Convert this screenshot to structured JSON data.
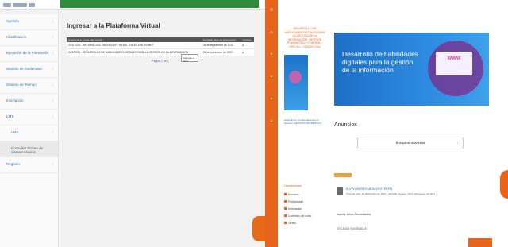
{
  "left": {
    "sidebar": [
      {
        "label": "Sysfinfo",
        "sub": false,
        "active": false
      },
      {
        "label": "Clasificación",
        "sub": false,
        "active": false
      },
      {
        "label": "Ejecución de la Formación",
        "sub": false,
        "active": false
      },
      {
        "label": "Gestión de Evidencias",
        "sub": false,
        "active": false
      },
      {
        "label": "Gestión de Tiempo",
        "sub": false,
        "active": false
      },
      {
        "label": "Inscripción",
        "sub": false,
        "active": false
      },
      {
        "label": "LMS",
        "sub": false,
        "active": false
      },
      {
        "label": "LMS",
        "sub": true,
        "active": false
      },
      {
        "label": "Consultar Fichas de Caracterización",
        "sub": true,
        "active": true
      },
      {
        "label": "Registro",
        "sub": false,
        "active": false
      }
    ],
    "title": "Ingresar a la Plataforma Virtual",
    "table": {
      "headers": [
        "Programa en el que esta inscrito",
        "Fecha de Inicio de la formación",
        "Ingresar"
      ],
      "rows": [
        [
          "GESTIÓN - INFORMÁTICA - MICROSOFT WORD, EXCEL E INTERNET",
          "05 de septiembre de 2021",
          ""
        ],
        [
          "GESTIÓN - DESARROLLO DE HABILIDADES DIGITALES PARA LA GESTIÓN DE LA INFORMACIÓN",
          "05 de noviembre de 2021",
          ""
        ]
      ]
    },
    "pager": "Página 1 de 1",
    "tooltip": "Ingresar a Terri"
  },
  "right": {
    "course_title": "DESARROLLO DE HABILIDADES DIGITALES PARA LA GESTIÓN DE LA INFORMACIÓN - GESTIÓN PLANEACIÓN Y CONTROL - VIRTUAL - CÓDIGO 2344",
    "course_meta": "Aprendiz en: cursos.sena.edu.co Sección: GESTIÓN INFORMÁTICA",
    "banner_text": "Desarrollo de habilidades digitales para la gestión de la información",
    "banner_www": "WWW",
    "anuncios": "Anuncios",
    "search_label": "Búsqueda avanzada",
    "menu_header": "Herramientas",
    "menu": [
      "Anuncios",
      "Participantes",
      "Información",
      "Contenido del curso",
      "Tareas"
    ],
    "post": {
      "author": "ELVIN ANDRÉS MEJÍA RESTREPO",
      "date": "lunes de ante, 31 de Octubre de 2021 - Inicio de: ingreso: 15 de Noviembre de 2021",
      "subject": "Asunto: Inicio Recordatorio",
      "body": "ESTUDIOS FAVORABLES"
    }
  },
  "colors": {
    "accent": "#e8641a",
    "green": "#2e8b3a",
    "link": "#2a6bbf"
  }
}
